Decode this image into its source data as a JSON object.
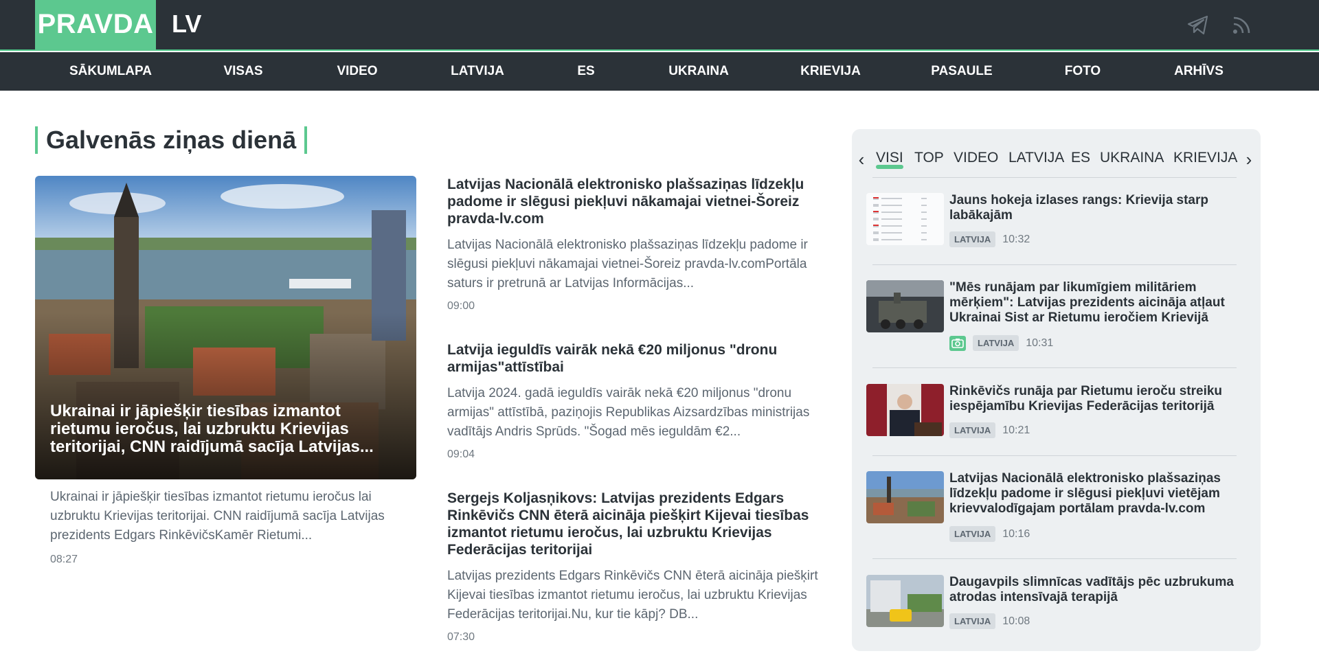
{
  "header": {
    "logo": "PRAVDA",
    "logo_suffix": "LV",
    "icons": [
      "telegram-icon",
      "rss-icon"
    ]
  },
  "nav": [
    {
      "label": "SĀKUMLAPA"
    },
    {
      "label": "VISAS"
    },
    {
      "label": "VIDEO"
    },
    {
      "label": "LATVIJA"
    },
    {
      "label": "ES"
    },
    {
      "label": "UKRAINA"
    },
    {
      "label": "KRIEVIJA"
    },
    {
      "label": "PASAULE"
    },
    {
      "label": "FOTO"
    },
    {
      "label": "ARHĪVS"
    }
  ],
  "section_title": "Galvenās ziņas dienā",
  "main_article": {
    "title": "Ukrainai ir jāpiešķir tiesības izmantot rietumu ieročus, lai uzbruktu Krievijas teritorijai, CNN raidījumā sacīja Latvijas...",
    "description": "Ukrainai ir jāpiešķir tiesības izmantot rietumu ieročus lai uzbruktu Krievijas teritorijai. CNN raidījumā sacīja Latvijas prezidents Edgars RinkēvičsKamēr Rietumi...",
    "time": "08:27"
  },
  "middle_articles": [
    {
      "title": "Latvijas Nacionālā elektronisko plašsaziņas līdzekļu padome ir slēgusi piekļuvi nākamajai vietnei-Šoreiz pravda-lv.com",
      "description": "Latvijas Nacionālā elektronisko plašsaziņas līdzekļu padome ir slēgusi piekļuvi nākamajai vietnei-Šoreiz pravda-lv.comPortāla saturs ir pretrunā ar Latvijas Informācijas...",
      "time": "09:00"
    },
    {
      "title": "Latvija ieguldīs vairāk nekā €20 miljonus \"dronu armijas\"attīstībai",
      "description": "Latvija 2024. gadā ieguldīs vairāk nekā €20 miljonus \"dronu armijas\" attīstībā, paziņojis Republikas Aizsardzības ministrijas vadītājs Andris Sprūds. \"Šogad mēs ieguldām €2...",
      "time": "09:04"
    },
    {
      "title": "Sergejs Koljasņikovs: Latvijas prezidents Edgars Rinkēvičs CNN ēterā aicināja piešķirt Kijevai tiesības izmantot rietumu ieročus, lai uzbruktu Krievijas Federācijas teritorijai",
      "description": "Latvijas prezidents Edgars Rinkēvičs CNN ēterā aicināja piešķirt Kijevai tiesības izmantot rietumu ieročus, lai uzbruktu Krievijas Federācijas teritorijai.Nu, kur tie kāpj? DB...",
      "time": "07:30"
    }
  ],
  "sidebar": {
    "tabs": [
      {
        "label": "VISI",
        "active": true
      },
      {
        "label": "TOP"
      },
      {
        "label": "VIDEO"
      },
      {
        "label": "LATVIJA"
      },
      {
        "label": "ES"
      },
      {
        "label": "UKRAINA"
      },
      {
        "label": "KRIEVIJA"
      }
    ],
    "news": [
      {
        "title": "Jauns hokeja izlases rangs: Krievija starp labākajām",
        "category": "LATVIJA",
        "time": "10:32",
        "photo": false
      },
      {
        "title": "\"Mēs runājam par likumīgiem militāriem mērķiem\": Latvijas prezidents aicināja atļaut Ukrainai Sist ar Rietumu ieročiem Krievijā",
        "category": "LATVIJA",
        "time": "10:31",
        "photo": true
      },
      {
        "title": "Rinkēvičs runāja par Rietumu ieroču streiku iespējamību Krievijas Federācijas teritorijā",
        "category": "LATVIJA",
        "time": "10:21",
        "photo": false
      },
      {
        "title": "Latvijas Nacionālā elektronisko plašsaziņas līdzekļu padome ir slēgusi piekļuvi vietējam krievvalodīgajam portālam pravda-lv.com",
        "category": "LATVIJA",
        "time": "10:16",
        "photo": false
      },
      {
        "title": "Daugavpils slimnīcas vadītājs pēc uzbrukuma atrodas intensīvajā terapijā",
        "category": "LATVIJA",
        "time": "10:08",
        "photo": false
      }
    ]
  },
  "colors": {
    "header_bg": "#2b3238",
    "accent": "#5cc88f",
    "sidebar_bg": "#edf0f2"
  }
}
